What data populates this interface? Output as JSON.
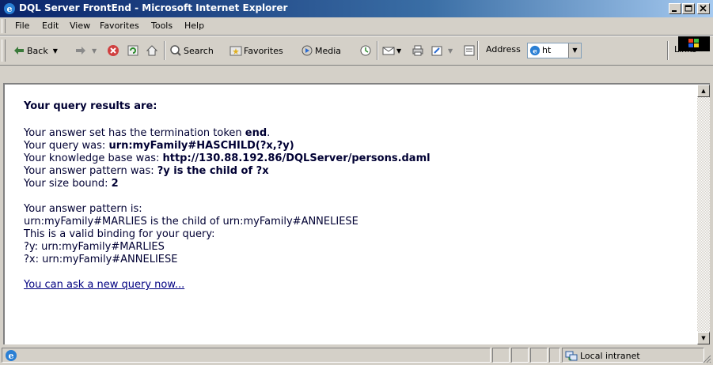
{
  "window": {
    "title": "DQL Server FrontEnd - Microsoft Internet Explorer",
    "controls": {
      "minimize": "_",
      "maximize": "□",
      "close": "×"
    }
  },
  "menubar": {
    "items": [
      "File",
      "Edit",
      "View",
      "Favorites",
      "Tools",
      "Help"
    ]
  },
  "toolbar": {
    "back_label": "Back",
    "search_label": "Search",
    "favorites_label": "Favorites",
    "media_label": "Media",
    "address_label": "Address",
    "address_value": "ht",
    "links_label": "Links",
    "links_chevron": "»"
  },
  "page": {
    "heading": "Your query results are:",
    "term_prefix": "Your answer set has the termination token ",
    "term_token": "end",
    "term_suffix": ".",
    "query_prefix": "Your query was: ",
    "query_value": "urn:myFamily#HASCHILD(?x,?y)",
    "kb_prefix": "Your knowledge base was: ",
    "kb_value": "http://130.88.192.86/DQLServer/persons.daml",
    "pattern_prefix": "Your answer pattern was: ",
    "pattern_value": "?y is the child of ?x",
    "size_prefix": "Your size bound: ",
    "size_value": "2",
    "answer_pattern_heading": "Your answer pattern is:",
    "answer_line": "urn:myFamily#MARLIES is the child of urn:myFamily#ANNELIESE",
    "valid_binding": "This is a valid binding for your query:",
    "binding_y": "?y: urn:myFamily#MARLIES",
    "binding_x": "?x: urn:myFamily#ANNELIESE",
    "new_query_link": "You can ask a new query now..."
  },
  "statusbar": {
    "zone_label": "Local intranet"
  }
}
